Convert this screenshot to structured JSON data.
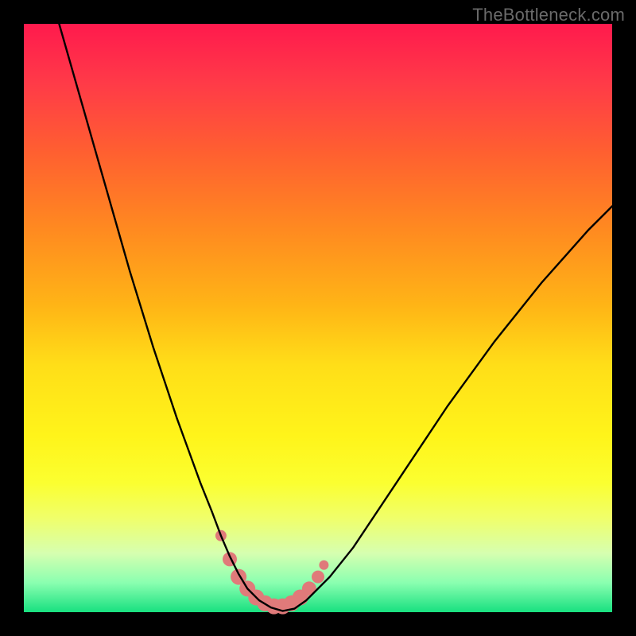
{
  "watermark": "TheBottleneck.com",
  "chart_data": {
    "type": "line",
    "title": "",
    "xlabel": "",
    "ylabel": "",
    "xlim": [
      0,
      100
    ],
    "ylim": [
      0,
      100
    ],
    "series": [
      {
        "name": "bottleneck-curve",
        "x": [
          6,
          8,
          10,
          12,
          14,
          16,
          18,
          20,
          22,
          24,
          26,
          28,
          30,
          32,
          33.5,
          35,
          36.5,
          38,
          40,
          42,
          44,
          46,
          48,
          52,
          56,
          60,
          64,
          68,
          72,
          76,
          80,
          84,
          88,
          92,
          96,
          100
        ],
        "values": [
          100,
          93,
          86,
          79,
          72,
          65,
          58,
          51.5,
          45,
          39,
          33,
          27.5,
          22,
          17,
          13,
          9.5,
          6.5,
          4,
          2,
          0.8,
          0.2,
          0.6,
          2,
          6,
          11,
          17,
          23,
          29,
          35,
          40.5,
          46,
          51,
          56,
          60.5,
          65,
          69
        ]
      }
    ],
    "markers": {
      "name": "highlight-dots",
      "color": "#e07a7a",
      "points": [
        {
          "x": 33.5,
          "y": 13,
          "r": 7
        },
        {
          "x": 35.0,
          "y": 9,
          "r": 9
        },
        {
          "x": 36.5,
          "y": 6,
          "r": 10
        },
        {
          "x": 38.0,
          "y": 4,
          "r": 10
        },
        {
          "x": 39.5,
          "y": 2.5,
          "r": 10
        },
        {
          "x": 41.0,
          "y": 1.5,
          "r": 10
        },
        {
          "x": 42.5,
          "y": 1.0,
          "r": 10
        },
        {
          "x": 44.0,
          "y": 1.0,
          "r": 10
        },
        {
          "x": 45.5,
          "y": 1.5,
          "r": 10
        },
        {
          "x": 47.0,
          "y": 2.5,
          "r": 10
        },
        {
          "x": 48.5,
          "y": 4,
          "r": 9
        },
        {
          "x": 50.0,
          "y": 6,
          "r": 8
        },
        {
          "x": 51.0,
          "y": 8,
          "r": 6
        }
      ]
    },
    "background_gradient": {
      "top": "#ff1a4d",
      "mid": "#ffde18",
      "bottom": "#18e080"
    }
  }
}
